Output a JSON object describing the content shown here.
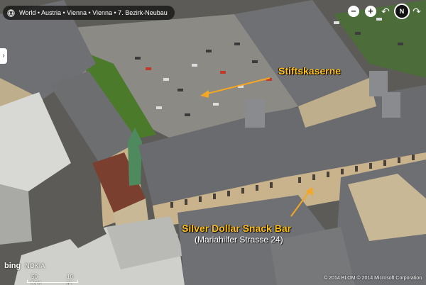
{
  "breadcrumb": {
    "text": "World • Austria • Vienna • Vienna • 7. Bezirk-Neubau"
  },
  "controls": {
    "zoom_out": "−",
    "zoom_in": "+",
    "compass_label": "N",
    "rotate_left": "↶",
    "rotate_right": "↷",
    "side_tab": "›"
  },
  "labels": {
    "stiftskaserne": "Stiftskaserne",
    "snackbar": "Silver Dollar Snack Bar",
    "address": "(Mariahilfer Strasse 24)"
  },
  "branding": {
    "bing": "bing",
    "nokia": "NOKIA"
  },
  "scale": {
    "feet": "50 feet",
    "meters": "10 m"
  },
  "copyright": "© 2014 BLOM   © 2014 Microsoft Corporation",
  "colors": {
    "label": "#ffc11a",
    "arrow": "#f5a623",
    "roof": "#6d6e70",
    "facade": "#c8b38d",
    "parking": "#8a8a86",
    "grass": "#4b7a2b"
  }
}
